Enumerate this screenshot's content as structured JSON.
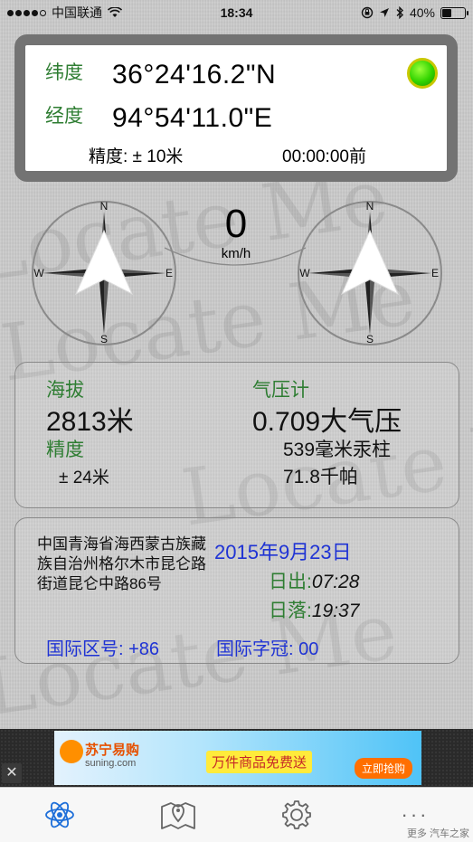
{
  "status_bar": {
    "carrier": "中国联通",
    "time": "18:34",
    "battery": "40%",
    "battery_level": 0.4
  },
  "location": {
    "lat_label": "纬度",
    "lat_value": "36°24'16.2\"N",
    "lon_label": "经度",
    "lon_value": "94°54'11.0\"E",
    "accuracy": "精度: ± 10米",
    "age": "00:00:00前",
    "gps_status_color": "#31d400"
  },
  "compass": {
    "n": "N",
    "s": "S",
    "e": "E",
    "w": "W",
    "speed_value": "0",
    "speed_unit": "km/h"
  },
  "altitude_panel": {
    "altitude_label": "海拔",
    "altitude_value": "2813米",
    "accuracy_label": "精度",
    "accuracy_value": "± 24米",
    "barometer_label": "气压计",
    "pressure_atm": "0.709大气压",
    "pressure_mmhg": "539毫米汞柱",
    "pressure_kpa": "71.8千帕"
  },
  "address_panel": {
    "address": "中国青海省海西蒙古族藏族自治州格尔木市昆仑路街道昆仑中路86号",
    "date": "2015年9月23日",
    "sunrise_label": "日出:",
    "sunrise_time": "07:28",
    "sunset_label": "日落:",
    "sunset_time": "19:37",
    "country_code": "国际区号: +86",
    "intl_prefix": "国际字冠: 00"
  },
  "ad": {
    "brand": "苏宁易购",
    "brand_url": "suning.com",
    "promo": "万件商品免费送",
    "cta": "立即抢购",
    "close": "✕"
  },
  "tab_bar": {
    "more": "···",
    "source_watermark": "更多 汽车之家"
  },
  "colors": {
    "label_green": "#2e7d32",
    "info_blue": "#1f33d4",
    "frame_gray": "#737373"
  },
  "watermark_text": "Locate Me"
}
